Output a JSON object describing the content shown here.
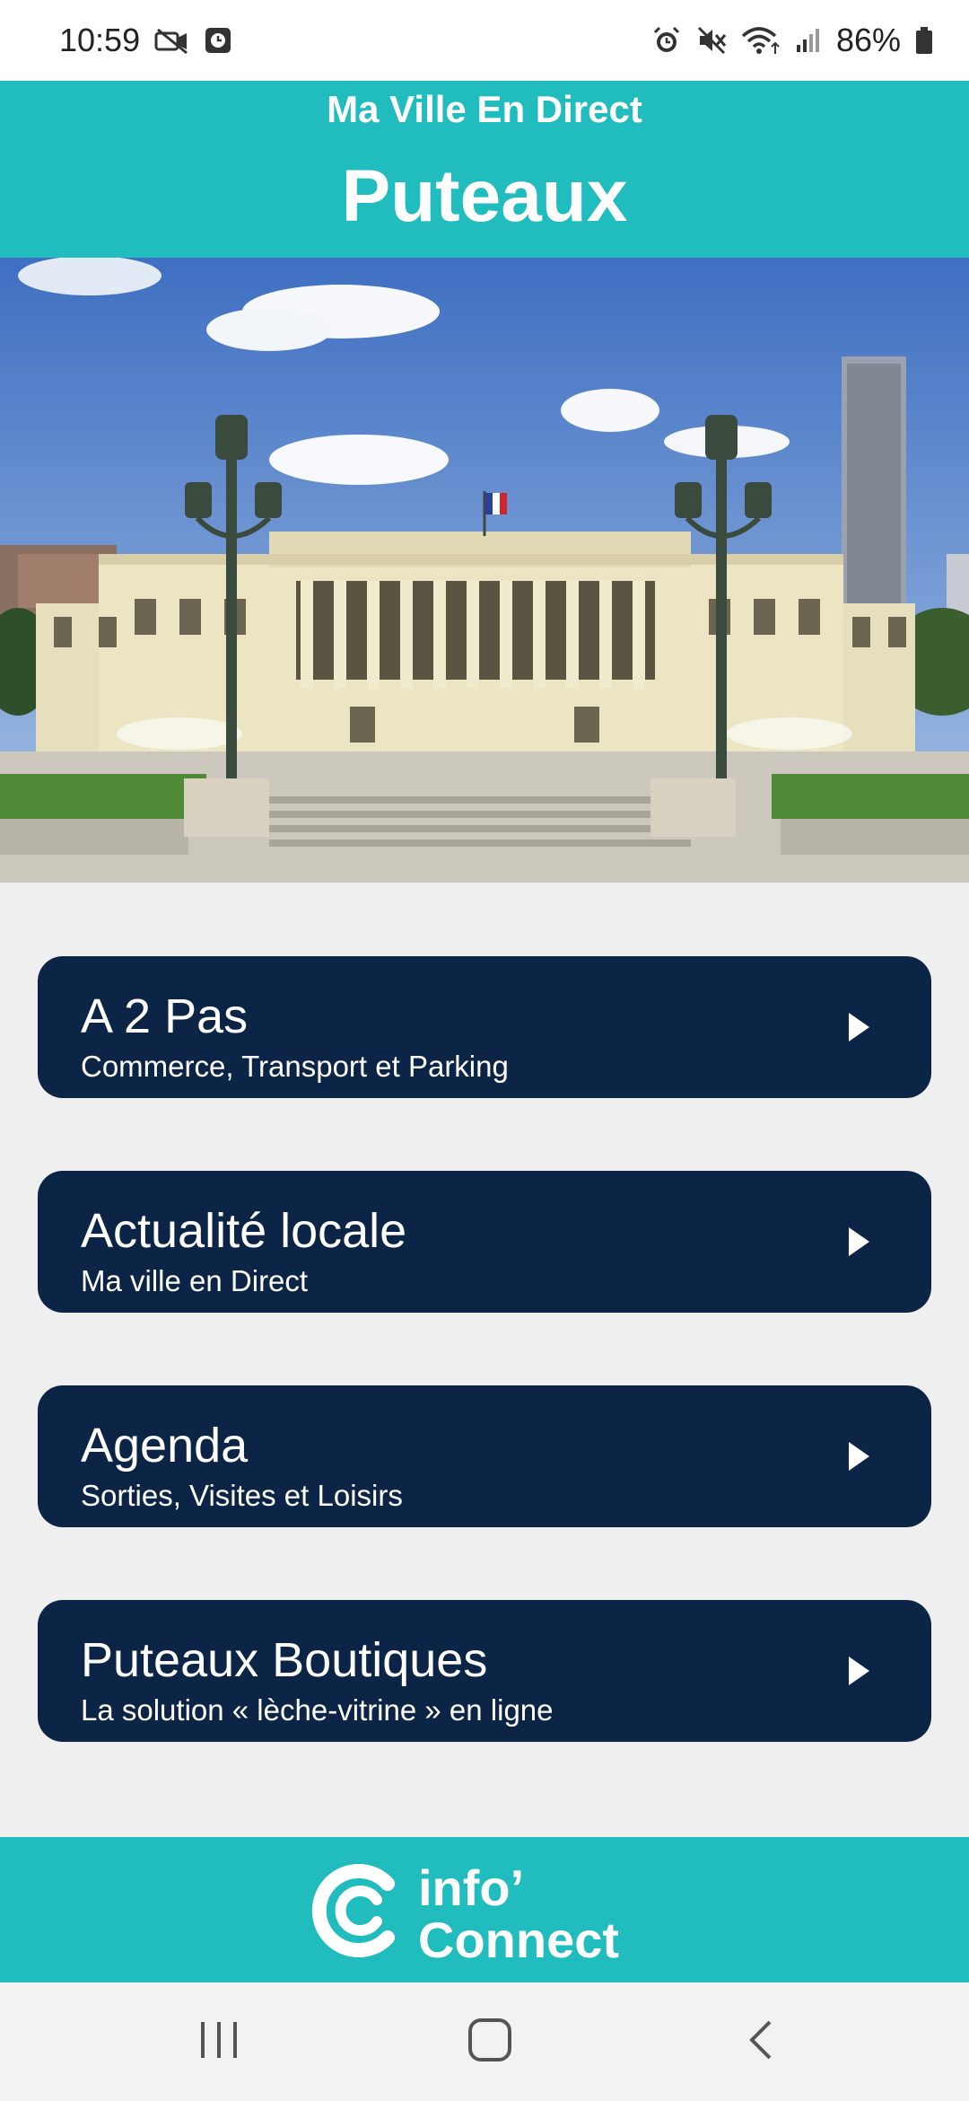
{
  "status_bar": {
    "time": "10:59",
    "battery": "86%",
    "icons_left": [
      "camera-off-icon",
      "clock-app-icon"
    ],
    "icons_right": [
      "alarm-icon",
      "mute-icon",
      "wifi-icon",
      "signal-icon",
      "battery-icon"
    ]
  },
  "header": {
    "subtitle": "Ma Ville En Direct",
    "title": "Puteaux",
    "color": "#21bcbd"
  },
  "hero": {
    "image": "town-hall-photo"
  },
  "menu": [
    {
      "title": "A 2 Pas",
      "subtitle": "Commerce, Transport et Parking"
    },
    {
      "title": "Actualité locale",
      "subtitle": "Ma ville en Direct"
    },
    {
      "title": "Agenda",
      "subtitle": "Sorties, Visites et Loisirs"
    },
    {
      "title": "Puteaux Boutiques",
      "subtitle": "La solution « lèche-vitrine » en ligne"
    }
  ],
  "footer": {
    "logo_line1": "info’",
    "logo_line2": "Connect"
  },
  "nav": {
    "buttons": [
      "recent-apps-icon",
      "home-icon",
      "back-icon"
    ]
  },
  "colors": {
    "accent": "#21bcbd",
    "card": "#0c2546",
    "background": "#efefef"
  }
}
